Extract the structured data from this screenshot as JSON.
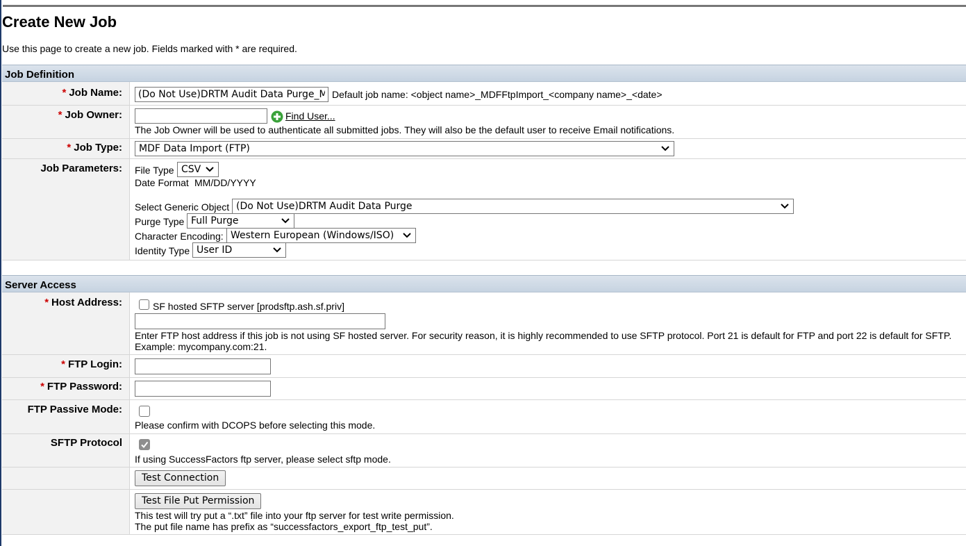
{
  "page": {
    "title": "Create New Job",
    "intro": "Use this page to create a new job. Fields marked with * are required."
  },
  "job_definition": {
    "header": "Job Definition",
    "required_marker": "*",
    "job_name": {
      "label": "Job Name:",
      "value": "(Do Not Use)DRTM Audit Data Purge_M",
      "hint": "Default job name: <object name>_MDFFtpImport_<company name>_<date>"
    },
    "job_owner": {
      "label": "Job Owner:",
      "value": "",
      "find_user": "Find User...",
      "hint": "The Job Owner will be used to authenticate all submitted jobs. They will also be the default user to receive Email notifications."
    },
    "job_type": {
      "label": "Job Type:",
      "value": "MDF Data Import (FTP)"
    },
    "job_parameters": {
      "label": "Job Parameters:",
      "file_type_label": "File Type",
      "file_type_value": "CSV",
      "date_format_label": "Date Format",
      "date_format_value": "MM/DD/YYYY",
      "generic_object_label": "Select Generic Object",
      "generic_object_value": "(Do Not Use)DRTM Audit Data Purge",
      "purge_type_label": "Purge Type",
      "purge_type_value": "Full Purge",
      "encoding_label": "Character Encoding:",
      "encoding_value": "Western European (Windows/ISO)",
      "identity_type_label": "Identity Type",
      "identity_type_value": "User ID"
    }
  },
  "server_access": {
    "header": "Server Access",
    "host_address": {
      "label": "Host Address:",
      "sf_hosted_label": "SF hosted SFTP server [prodsftp.ash.sf.priv]",
      "sf_hosted_checked": false,
      "value": "",
      "hint_line1": "Enter FTP host address if this job is not using SF hosted server. For security reason, it is highly recommended to use SFTP protocol. Port 21 is default for FTP and port 22 is default for SFTP.",
      "hint_line2": "Example: mycompany.com:21."
    },
    "ftp_login": {
      "label": "FTP Login:",
      "value": ""
    },
    "ftp_password": {
      "label": "FTP Password:",
      "value": ""
    },
    "ftp_passive_mode": {
      "label": "FTP Passive Mode:",
      "checked": false,
      "hint": "Please confirm with DCOPS before selecting this mode."
    },
    "sftp_protocol": {
      "label": "SFTP Protocol",
      "checked": true,
      "hint": "If using SuccessFactors ftp server, please select sftp mode."
    },
    "test_connection_button": "Test Connection",
    "test_put_button": "Test File Put Permission",
    "test_put_hint_line1": "This test will try put a “.txt” file into your ftp server for test write permission.",
    "test_put_hint_line2": "The put file name has prefix as “successfactors_export_ftp_test_put”."
  },
  "icons": {
    "find_user": "add-circle-icon",
    "dropdown": "chevron-down-icon",
    "checkmark": "checkmark-icon"
  },
  "colors": {
    "required": "#cc0000",
    "section_header": "#c6d3e1",
    "find_user_icon": "#3aa23a"
  }
}
